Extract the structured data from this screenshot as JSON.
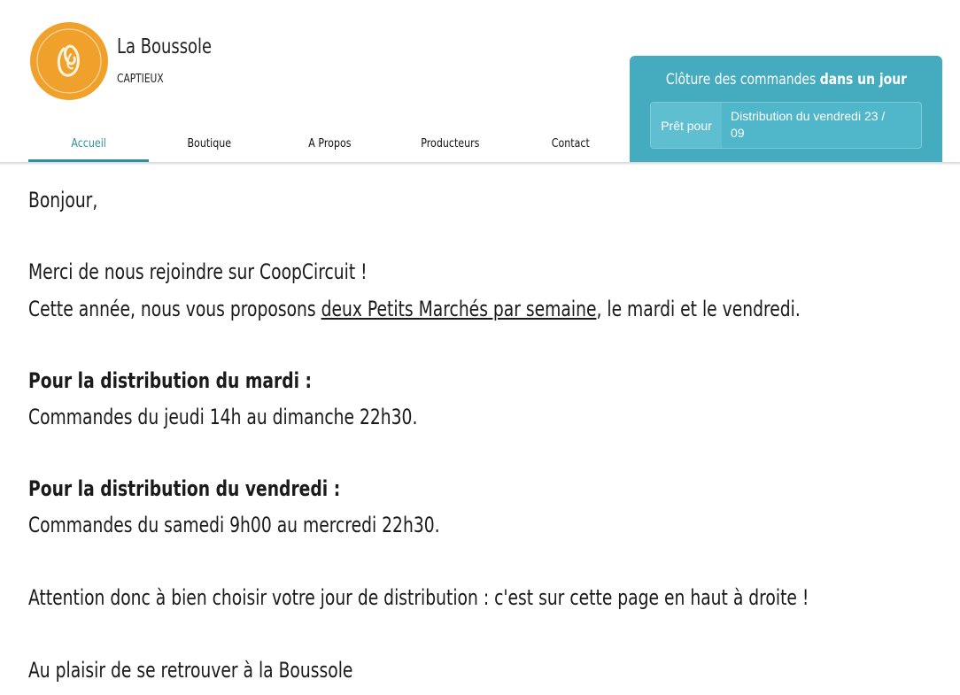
{
  "shop": {
    "name": "La Boussole",
    "city": "CAPTIEUX",
    "logo_text": "La Boussole"
  },
  "nav": {
    "items": [
      {
        "label": "Accueil",
        "active": true
      },
      {
        "label": "Boutique",
        "active": false
      },
      {
        "label": "A Propos",
        "active": false
      },
      {
        "label": "Producteurs",
        "active": false
      },
      {
        "label": "Contact",
        "active": false
      }
    ]
  },
  "orders_panel": {
    "title_prefix": "Clôture des commandes",
    "title_bold": "dans un jour",
    "ready_label": "Prêt pour",
    "distribution_line1": "Distribution du vendredi 23 /",
    "distribution_line2": "09"
  },
  "content": {
    "greeting": "Bonjour,",
    "welcome": "Merci de nous rejoindre sur CoopCircuit !",
    "intro_before": "Cette année, nous vous proposons ",
    "intro_link": "deux Petits Marchés par semaine",
    "intro_after": ", le mardi et le vendredi.",
    "tuesday_heading": "Pour la distribution du mardi :",
    "tuesday_text": "Commandes du jeudi 14h au dimanche 22h30.",
    "friday_heading": "Pour la distribution du vendredi :",
    "friday_text": "Commandes du samedi 9h00 au mercredi 22h30.",
    "attention": "Attention donc à bien choisir votre jour de distribution : c'est sur cette page en haut à droite !",
    "closing": "Au plaisir de se retrouver à la Boussole"
  },
  "colors": {
    "accent": "#2f8f9a",
    "panel": "#45acc0",
    "logo": "#f0a12c"
  }
}
